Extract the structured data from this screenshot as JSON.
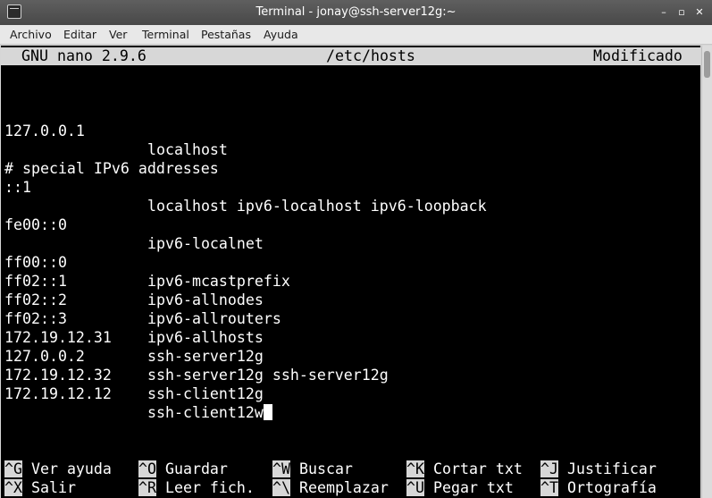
{
  "window": {
    "title": "Terminal - jonay@ssh-server12g:~",
    "icon": "terminal-icon",
    "controls": [
      "–",
      "▫",
      "✕"
    ]
  },
  "menubar": [
    "Archivo",
    "Editar",
    "Ver",
    "Terminal",
    "Pestañas",
    "Ayuda"
  ],
  "nano": {
    "version": "GNU nano 2.9.6",
    "file": "/etc/hosts",
    "status": "Modificado"
  },
  "hosts": [
    {
      "addr": "127.0.0.1",
      "names": "localhost"
    },
    {
      "addr": "",
      "names": ""
    },
    {
      "addr": "# special IPv6 addresses",
      "names": ""
    },
    {
      "addr": "::1",
      "names": "localhost ipv6-localhost ipv6-loopback"
    },
    {
      "addr": "",
      "names": ""
    },
    {
      "addr": "fe00::0",
      "names": "ipv6-localnet"
    },
    {
      "addr": "",
      "names": ""
    },
    {
      "addr": "ff00::0",
      "names": "ipv6-mcastprefix"
    },
    {
      "addr": "ff02::1",
      "names": "ipv6-allnodes"
    },
    {
      "addr": "ff02::2",
      "names": "ipv6-allrouters"
    },
    {
      "addr": "ff02::3",
      "names": "ipv6-allhosts"
    },
    {
      "addr": "172.19.12.31",
      "names": "ssh-server12g"
    },
    {
      "addr": "127.0.0.2",
      "names": "ssh-server12g ssh-server12g"
    },
    {
      "addr": "172.19.12.32",
      "names": "ssh-client12g"
    },
    {
      "addr": "172.19.12.12",
      "names": "ssh-client12w"
    }
  ],
  "shortcuts": [
    {
      "key": "^G",
      "label": "Ver ayuda"
    },
    {
      "key": "^O",
      "label": "Guardar"
    },
    {
      "key": "^W",
      "label": "Buscar"
    },
    {
      "key": "^K",
      "label": "Cortar txt"
    },
    {
      "key": "^J",
      "label": "Justificar"
    },
    {
      "key": "^X",
      "label": "Salir"
    },
    {
      "key": "^R",
      "label": "Leer fich."
    },
    {
      "key": "^\\",
      "label": "Reemplazar"
    },
    {
      "key": "^U",
      "label": "Pegar txt"
    },
    {
      "key": "^T",
      "label": "Ortografía"
    }
  ]
}
